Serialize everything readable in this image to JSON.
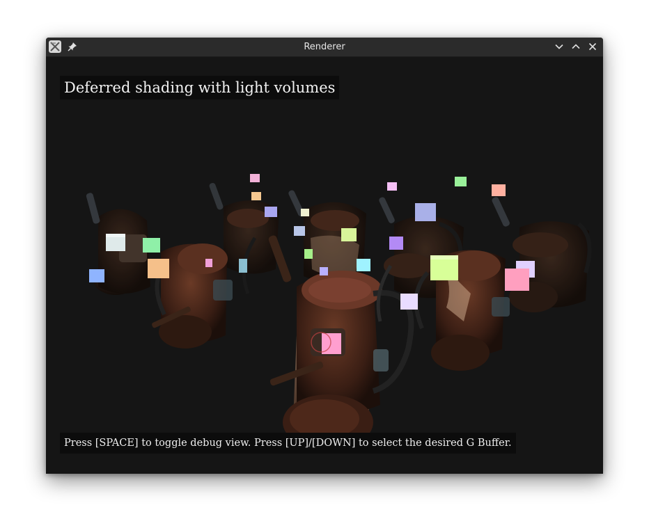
{
  "window": {
    "title": "Renderer",
    "icons": [
      "app-icon",
      "pin-icon",
      "minimize-icon",
      "maximize-icon",
      "close-icon"
    ]
  },
  "overlay": {
    "title": "Deferred shading with light volumes",
    "hint": "Press [SPACE] to toggle debug view. Press [UP]/[DOWN] to select the desired G Buffer."
  },
  "colors": {
    "background": "#151515",
    "titlebar": "#2b2b2b",
    "light_colors": [
      "#dfeaea",
      "#8ff0a8",
      "#f5c08a",
      "#8fb4ff",
      "#f2b2d8",
      "#f5c890",
      "#a9a6f0",
      "#9ff2ff",
      "#d8f59a",
      "#b38af5",
      "#ff9fbf",
      "#99f099",
      "#ffb0a0"
    ]
  }
}
